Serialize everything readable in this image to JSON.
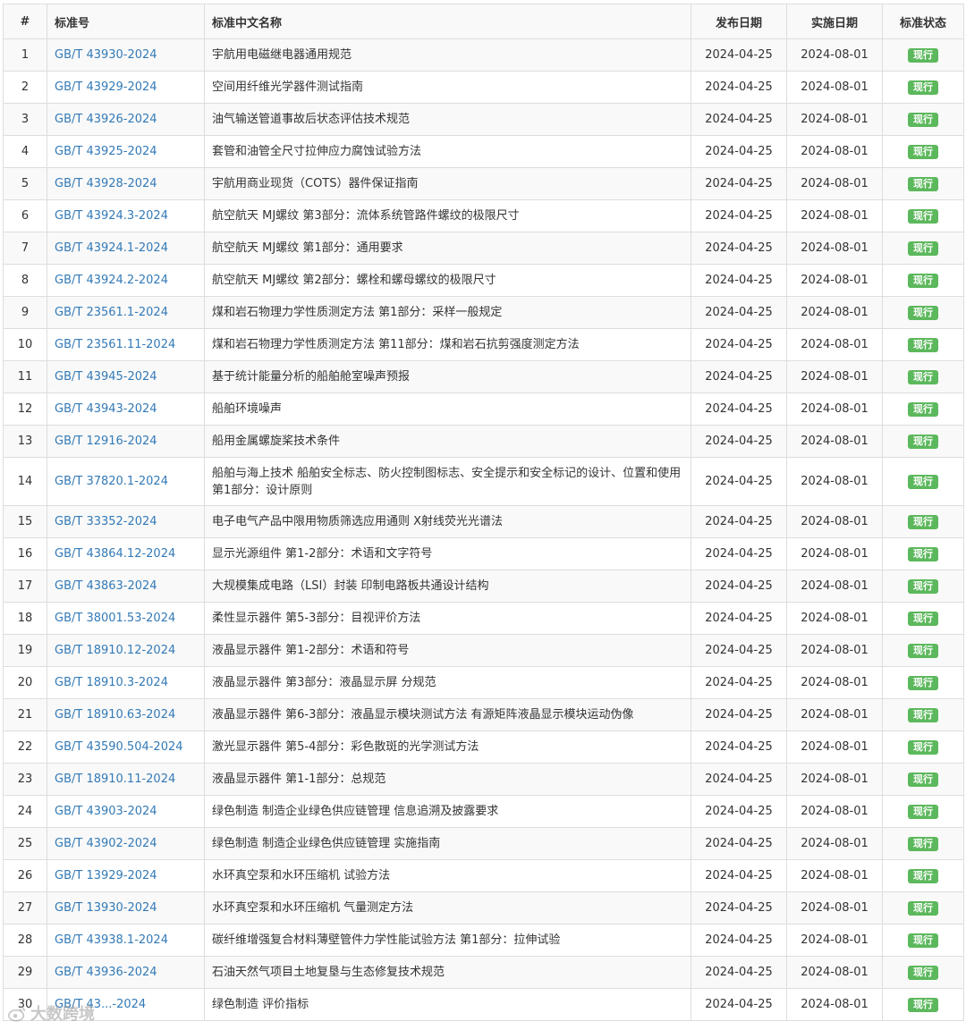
{
  "table": {
    "headers": {
      "num": "#",
      "code": "标准号",
      "name": "标准中文名称",
      "release": "发布日期",
      "implement": "实施日期",
      "status": "标准状态"
    },
    "rows": [
      {
        "num": "1",
        "code": "GB/T 43930-2024",
        "name": "宇航用电磁继电器通用规范",
        "release": "2024-04-25",
        "implement": "2024-08-01",
        "status": "现行"
      },
      {
        "num": "2",
        "code": "GB/T 43929-2024",
        "name": "空间用纤维光学器件测试指南",
        "release": "2024-04-25",
        "implement": "2024-08-01",
        "status": "现行"
      },
      {
        "num": "3",
        "code": "GB/T 43926-2024",
        "name": "油气输送管道事故后状态评估技术规范",
        "release": "2024-04-25",
        "implement": "2024-08-01",
        "status": "现行"
      },
      {
        "num": "4",
        "code": "GB/T 43925-2024",
        "name": "套管和油管全尺寸拉伸应力腐蚀试验方法",
        "release": "2024-04-25",
        "implement": "2024-08-01",
        "status": "现行"
      },
      {
        "num": "5",
        "code": "GB/T 43928-2024",
        "name": "宇航用商业现货（COTS）器件保证指南",
        "release": "2024-04-25",
        "implement": "2024-08-01",
        "status": "现行"
      },
      {
        "num": "6",
        "code": "GB/T 43924.3-2024",
        "name": "航空航天 MJ螺纹 第3部分：流体系统管路件螺纹的极限尺寸",
        "release": "2024-04-25",
        "implement": "2024-08-01",
        "status": "现行"
      },
      {
        "num": "7",
        "code": "GB/T 43924.1-2024",
        "name": "航空航天 MJ螺纹 第1部分：通用要求",
        "release": "2024-04-25",
        "implement": "2024-08-01",
        "status": "现行"
      },
      {
        "num": "8",
        "code": "GB/T 43924.2-2024",
        "name": "航空航天 MJ螺纹 第2部分：螺栓和螺母螺纹的极限尺寸",
        "release": "2024-04-25",
        "implement": "2024-08-01",
        "status": "现行"
      },
      {
        "num": "9",
        "code": "GB/T 23561.1-2024",
        "name": "煤和岩石物理力学性质测定方法 第1部分：采样一般规定",
        "release": "2024-04-25",
        "implement": "2024-08-01",
        "status": "现行"
      },
      {
        "num": "10",
        "code": "GB/T 23561.11-2024",
        "name": "煤和岩石物理力学性质测定方法 第11部分：煤和岩石抗剪强度测定方法",
        "release": "2024-04-25",
        "implement": "2024-08-01",
        "status": "现行"
      },
      {
        "num": "11",
        "code": "GB/T 43945-2024",
        "name": "基于统计能量分析的船舶舱室噪声预报",
        "release": "2024-04-25",
        "implement": "2024-08-01",
        "status": "现行"
      },
      {
        "num": "12",
        "code": "GB/T 43943-2024",
        "name": "船舶环境噪声",
        "release": "2024-04-25",
        "implement": "2024-08-01",
        "status": "现行"
      },
      {
        "num": "13",
        "code": "GB/T 12916-2024",
        "name": "船用金属螺旋桨技术条件",
        "release": "2024-04-25",
        "implement": "2024-08-01",
        "status": "现行"
      },
      {
        "num": "14",
        "code": "GB/T 37820.1-2024",
        "name": "船舶与海上技术 船舶安全标志、防火控制图标志、安全提示和安全标记的设计、位置和使用 第1部分：设计原则",
        "release": "2024-04-25",
        "implement": "2024-08-01",
        "status": "现行"
      },
      {
        "num": "15",
        "code": "GB/T 33352-2024",
        "name": "电子电气产品中限用物质筛选应用通则 X射线荧光光谱法",
        "release": "2024-04-25",
        "implement": "2024-08-01",
        "status": "现行"
      },
      {
        "num": "16",
        "code": "GB/T 43864.12-2024",
        "name": "显示光源组件 第1-2部分：术语和文字符号",
        "release": "2024-04-25",
        "implement": "2024-08-01",
        "status": "现行"
      },
      {
        "num": "17",
        "code": "GB/T 43863-2024",
        "name": "大规模集成电路（LSI）封装 印制电路板共通设计结构",
        "release": "2024-04-25",
        "implement": "2024-08-01",
        "status": "现行"
      },
      {
        "num": "18",
        "code": "GB/T 38001.53-2024",
        "name": "柔性显示器件 第5-3部分：目视评价方法",
        "release": "2024-04-25",
        "implement": "2024-08-01",
        "status": "现行"
      },
      {
        "num": "19",
        "code": "GB/T 18910.12-2024",
        "name": "液晶显示器件 第1-2部分：术语和符号",
        "release": "2024-04-25",
        "implement": "2024-08-01",
        "status": "现行"
      },
      {
        "num": "20",
        "code": "GB/T 18910.3-2024",
        "name": "液晶显示器件 第3部分：液晶显示屏 分规范",
        "release": "2024-04-25",
        "implement": "2024-08-01",
        "status": "现行"
      },
      {
        "num": "21",
        "code": "GB/T 18910.63-2024",
        "name": "液晶显示器件 第6-3部分：液晶显示模块测试方法 有源矩阵液晶显示模块运动伪像",
        "release": "2024-04-25",
        "implement": "2024-08-01",
        "status": "现行"
      },
      {
        "num": "22",
        "code": "GB/T 43590.504-2024",
        "name": "激光显示器件 第5-4部分：彩色散斑的光学测试方法",
        "release": "2024-04-25",
        "implement": "2024-08-01",
        "status": "现行"
      },
      {
        "num": "23",
        "code": "GB/T 18910.11-2024",
        "name": "液晶显示器件 第1-1部分：总规范",
        "release": "2024-04-25",
        "implement": "2024-08-01",
        "status": "现行"
      },
      {
        "num": "24",
        "code": "GB/T 43903-2024",
        "name": "绿色制造 制造企业绿色供应链管理 信息追溯及披露要求",
        "release": "2024-04-25",
        "implement": "2024-08-01",
        "status": "现行"
      },
      {
        "num": "25",
        "code": "GB/T 43902-2024",
        "name": "绿色制造 制造企业绿色供应链管理 实施指南",
        "release": "2024-04-25",
        "implement": "2024-08-01",
        "status": "现行"
      },
      {
        "num": "26",
        "code": "GB/T 13929-2024",
        "name": "水环真空泵和水环压缩机 试验方法",
        "release": "2024-04-25",
        "implement": "2024-08-01",
        "status": "现行"
      },
      {
        "num": "27",
        "code": "GB/T 13930-2024",
        "name": "水环真空泵和水环压缩机 气量测定方法",
        "release": "2024-04-25",
        "implement": "2024-08-01",
        "status": "现行"
      },
      {
        "num": "28",
        "code": "GB/T 43938.1-2024",
        "name": "碳纤维增强复合材料薄壁管件力学性能试验方法 第1部分：拉伸试验",
        "release": "2024-04-25",
        "implement": "2024-08-01",
        "status": "现行"
      },
      {
        "num": "29",
        "code": "GB/T 43936-2024",
        "name": "石油天然气项目土地复垦与生态修复技术规范",
        "release": "2024-04-25",
        "implement": "2024-08-01",
        "status": "现行"
      },
      {
        "num": "30",
        "code": "GB/T 43...-2024",
        "name": "绿色制造 评价指标",
        "release": "2024-04-25",
        "implement": "2024-08-01",
        "status": "现行"
      }
    ]
  },
  "watermark": {
    "text": "大数跨境",
    "icon": "weibo-logo-icon"
  }
}
